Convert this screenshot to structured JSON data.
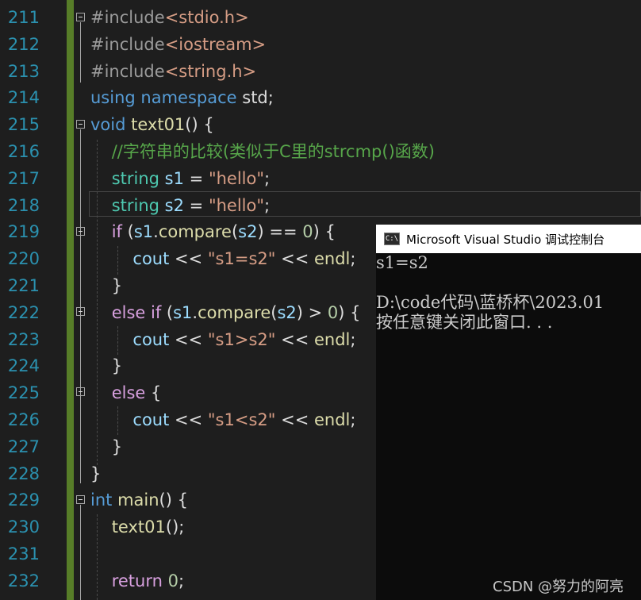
{
  "editor": {
    "lines": [
      {
        "num": "211",
        "tokens": [
          {
            "t": "#include",
            "c": "pp"
          },
          {
            "t": "<stdio.h>",
            "c": "hdr"
          }
        ]
      },
      {
        "num": "212",
        "tokens": [
          {
            "t": "#include",
            "c": "pp"
          },
          {
            "t": "<iostream>",
            "c": "hdr"
          }
        ]
      },
      {
        "num": "213",
        "tokens": [
          {
            "t": "#include",
            "c": "pp"
          },
          {
            "t": "<string.h>",
            "c": "hdr"
          }
        ]
      },
      {
        "num": "214",
        "tokens": [
          {
            "t": "using ",
            "c": "kw"
          },
          {
            "t": "namespace ",
            "c": "kw"
          },
          {
            "t": "std;",
            "c": ""
          }
        ]
      },
      {
        "num": "215",
        "tokens": [
          {
            "t": "void ",
            "c": "kw"
          },
          {
            "t": "text01",
            "c": "fn"
          },
          {
            "t": "() {",
            "c": ""
          }
        ]
      },
      {
        "num": "216",
        "tokens": [
          {
            "t": "    //字符串的比较(类似于C里的strcmp()函数)",
            "c": "cm"
          }
        ]
      },
      {
        "num": "217",
        "tokens": [
          {
            "t": "    string ",
            "c": "ty"
          },
          {
            "t": "s1",
            "c": "id"
          },
          {
            "t": " = ",
            "c": ""
          },
          {
            "t": "\"hello\"",
            "c": "st"
          },
          {
            "t": ";",
            "c": ""
          }
        ]
      },
      {
        "num": "218",
        "tokens": [
          {
            "t": "    string ",
            "c": "ty"
          },
          {
            "t": "s2",
            "c": "id"
          },
          {
            "t": " = ",
            "c": ""
          },
          {
            "t": "\"hello\"",
            "c": "st"
          },
          {
            "t": ";",
            "c": ""
          }
        ]
      },
      {
        "num": "219",
        "tokens": [
          {
            "t": "    if ",
            "c": "ctl"
          },
          {
            "t": "(",
            "c": ""
          },
          {
            "t": "s1",
            "c": "id"
          },
          {
            "t": ".",
            "c": ""
          },
          {
            "t": "compare",
            "c": "fn"
          },
          {
            "t": "(",
            "c": ""
          },
          {
            "t": "s2",
            "c": "id"
          },
          {
            "t": ") == ",
            "c": ""
          },
          {
            "t": "0",
            "c": "nm"
          },
          {
            "t": ") {",
            "c": ""
          }
        ]
      },
      {
        "num": "220",
        "tokens": [
          {
            "t": "        cout",
            "c": "id"
          },
          {
            "t": " << ",
            "c": ""
          },
          {
            "t": "\"s1=s2\"",
            "c": "st"
          },
          {
            "t": " << ",
            "c": ""
          },
          {
            "t": "endl",
            "c": "fn"
          },
          {
            "t": ";",
            "c": ""
          }
        ]
      },
      {
        "num": "221",
        "tokens": [
          {
            "t": "    }",
            "c": ""
          }
        ]
      },
      {
        "num": "222",
        "tokens": [
          {
            "t": "    else if ",
            "c": "ctl"
          },
          {
            "t": "(",
            "c": ""
          },
          {
            "t": "s1",
            "c": "id"
          },
          {
            "t": ".",
            "c": ""
          },
          {
            "t": "compare",
            "c": "fn"
          },
          {
            "t": "(",
            "c": ""
          },
          {
            "t": "s2",
            "c": "id"
          },
          {
            "t": ") > ",
            "c": ""
          },
          {
            "t": "0",
            "c": "nm"
          },
          {
            "t": ") {",
            "c": ""
          }
        ]
      },
      {
        "num": "223",
        "tokens": [
          {
            "t": "        cout",
            "c": "id"
          },
          {
            "t": " << ",
            "c": ""
          },
          {
            "t": "\"s1>s2\"",
            "c": "st"
          },
          {
            "t": " << ",
            "c": ""
          },
          {
            "t": "endl",
            "c": "fn"
          },
          {
            "t": ";",
            "c": ""
          }
        ]
      },
      {
        "num": "224",
        "tokens": [
          {
            "t": "    }",
            "c": ""
          }
        ]
      },
      {
        "num": "225",
        "tokens": [
          {
            "t": "    else ",
            "c": "ctl"
          },
          {
            "t": "{",
            "c": ""
          }
        ]
      },
      {
        "num": "226",
        "tokens": [
          {
            "t": "        cout",
            "c": "id"
          },
          {
            "t": " << ",
            "c": ""
          },
          {
            "t": "\"s1<s2\"",
            "c": "st"
          },
          {
            "t": " << ",
            "c": ""
          },
          {
            "t": "endl",
            "c": "fn"
          },
          {
            "t": ";",
            "c": ""
          }
        ]
      },
      {
        "num": "227",
        "tokens": [
          {
            "t": "    }",
            "c": ""
          }
        ]
      },
      {
        "num": "228",
        "tokens": [
          {
            "t": "}",
            "c": ""
          }
        ]
      },
      {
        "num": "229",
        "tokens": [
          {
            "t": "int ",
            "c": "kw"
          },
          {
            "t": "main",
            "c": "fn"
          },
          {
            "t": "() {",
            "c": ""
          }
        ]
      },
      {
        "num": "230",
        "tokens": [
          {
            "t": "    text01",
            "c": "fn"
          },
          {
            "t": "();",
            "c": ""
          }
        ]
      },
      {
        "num": "231",
        "tokens": [
          {
            "t": "",
            "c": ""
          }
        ]
      },
      {
        "num": "232",
        "tokens": [
          {
            "t": "    return ",
            "c": "ctl"
          },
          {
            "t": "0",
            "c": "nm"
          },
          {
            "t": ";",
            "c": ""
          }
        ]
      }
    ]
  },
  "console": {
    "icon": "C:\\",
    "title": "Microsoft Visual Studio 调试控制台",
    "output": [
      "s1=s2",
      "",
      "D:\\code代码\\蓝桥杯\\2023.01",
      "按任意键关闭此窗口. . ."
    ]
  },
  "watermark": "CSDN @努力的阿亮",
  "colors": {
    "background": "#1e1e1e",
    "line_number": "#2b91af",
    "keyword": "#569cd6",
    "comment": "#57a64a",
    "string": "#d69d85",
    "function": "#dcdcaa",
    "type": "#4ec9b0",
    "identifier": "#9cdcfe",
    "control": "#d8a0df",
    "number": "#b5cea8",
    "modified_bar": "#577d28"
  }
}
